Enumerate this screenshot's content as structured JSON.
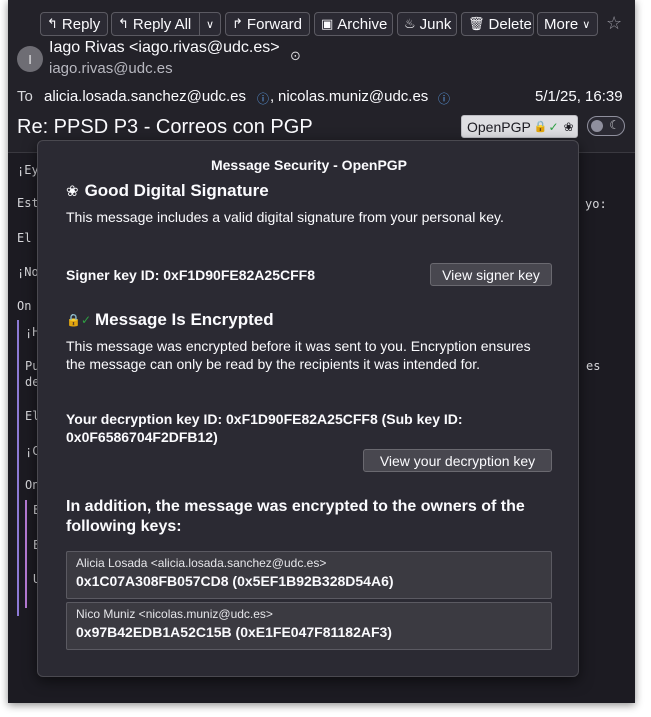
{
  "toolbar": {
    "reply": "Reply",
    "reply_all": "Reply All",
    "forward": "Forward",
    "archive": "Archive",
    "junk": "Junk",
    "delete": "Delete",
    "more": "More"
  },
  "header": {
    "avatar_initial": "I",
    "from_name": "Iago Rivas <iago.rivas@udc.es>",
    "from_email": "iago.rivas@udc.es",
    "to_label": "To",
    "recipients": [
      "alicia.losada.sanchez@udc.es",
      "nicolas.muniz@udc.es"
    ],
    "separator": ",",
    "date": "5/1/25, 16:39",
    "subject": "Re: PPSD P3 - Correos con PGP",
    "openpgp_label": "OpenPGP"
  },
  "message_body": {
    "lines": [
      "¡Ey",
      "Est",
      "El",
      "¡No",
      "On",
      "¡H",
      "Pu",
      "de",
      "El",
      "¡C",
      "On",
      "E",
      "E",
      "U"
    ],
    "right_fragments": [
      "yo:",
      "es"
    ]
  },
  "security_popup": {
    "title": "Message Security - OpenPGP",
    "signature": {
      "heading": "Good Digital Signature",
      "text": "This message includes a valid digital signature from your personal key.",
      "signer_key": "Signer key ID: 0xF1D90FE82A25CFF8",
      "view_button": "View signer key"
    },
    "encryption": {
      "heading": "Message Is Encrypted",
      "text": "This message was encrypted before it was sent to you. Encryption ensures the message can only be read by the recipients it was intended for.",
      "decryption_key": "Your decryption key ID: 0xF1D90FE82A25CFF8 (Sub key ID: 0x0F6586704F2DFB12)",
      "view_button": "View your decryption key"
    },
    "additional": {
      "heading": "In addition, the message was encrypted to the owners of the following keys:",
      "keys": [
        {
          "name": "Alicia Losada <alicia.losada.sanchez@udc.es>",
          "id": "0x1C07A308FB057CD8 (0x5EF1B92B328D54A6)"
        },
        {
          "name": "Nico Muniz <nicolas.muniz@udc.es>",
          "id": "0x97B42EDB1A52C15B (0xE1FE047F81182AF3)"
        }
      ]
    }
  },
  "colors": {
    "window_bg": "#1c1b22",
    "popup_bg": "#2b2a33",
    "contact_icon": "#5fa2ee",
    "verified_check": "#2ea043",
    "quote_bar": "#8c7ad6"
  }
}
